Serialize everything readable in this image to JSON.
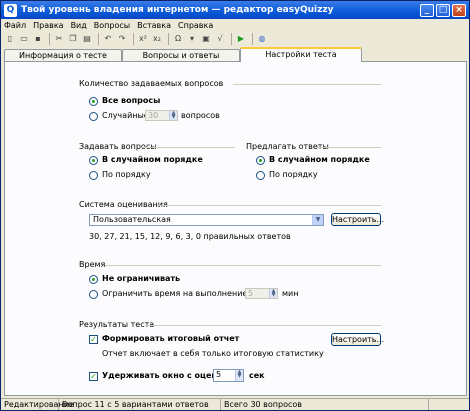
{
  "window": {
    "title": "Твой уровень владения интернетом — редактор easyQuizzy",
    "app_icon": "Q"
  },
  "menu": [
    "Файл",
    "Правка",
    "Вид",
    "Вопросы",
    "Вставка",
    "Справка"
  ],
  "tabs": [
    {
      "label": "Информация о тесте"
    },
    {
      "label": "Вопросы и ответы"
    },
    {
      "label": "Настройки теста"
    }
  ],
  "questions_count": {
    "heading": "Количество задаваемых вопросов",
    "all_label": "Все вопросы",
    "random_label": "Случайные",
    "random_value": "30",
    "random_suffix": "вопросов"
  },
  "ask_questions": {
    "heading": "Задавать вопросы",
    "random_order": "В случайном порядке",
    "in_order": "По порядку"
  },
  "offer_answers": {
    "heading": "Предлагать ответы",
    "random_order": "В случайном порядке",
    "in_order": "По порядку"
  },
  "grading": {
    "heading": "Система оценивания",
    "selected": "Пользовательская",
    "configure_label": "Настроить...",
    "thresholds": "30, 27, 21, 15, 12, 9, 6, 3, 0 правильных ответов"
  },
  "time": {
    "heading": "Время",
    "unlimited": "Не ограничивать",
    "limit_label": "Ограничить время на выполнение теста",
    "limit_value": "5",
    "limit_suffix": "мин"
  },
  "results": {
    "heading": "Результаты теста",
    "report_label": "Формировать итоговый отчет",
    "configure_label": "Настроить...",
    "report_desc": "Отчет включает в себя только итоговую статистику",
    "hold_label": "Удерживать окно с оценкой",
    "hold_value": "5",
    "hold_suffix": "сек"
  },
  "statusbar": {
    "mode": "Редактирование",
    "question": "Вопрос 11 с 5 вариантами ответов",
    "total": "Всего 30 вопросов"
  }
}
